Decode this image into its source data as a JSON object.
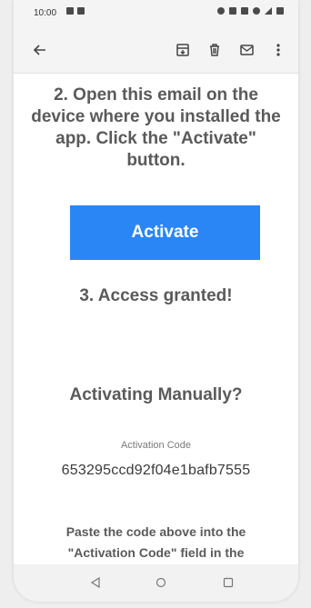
{
  "status_bar": {
    "time": "10:00"
  },
  "app_bar": {
    "icons": [
      "back-arrow-icon",
      "archive-icon",
      "trash-icon",
      "mail-icon",
      "more-vert-icon"
    ]
  },
  "email": {
    "step2": "2. Open this email on the device where you installed the app. Click the \"Activate\" button.",
    "activate_label": "Activate",
    "step3": "3. Access granted!",
    "manual_title": "Activating Manually?",
    "code_label": "Activation Code",
    "code_value": "653295ccd92f04e1bafb7555",
    "paste_text": "Paste the code above into the \"Activation Code\" field in the"
  },
  "colors": {
    "accent": "#2b86f5",
    "text": "#5a5a5a"
  }
}
